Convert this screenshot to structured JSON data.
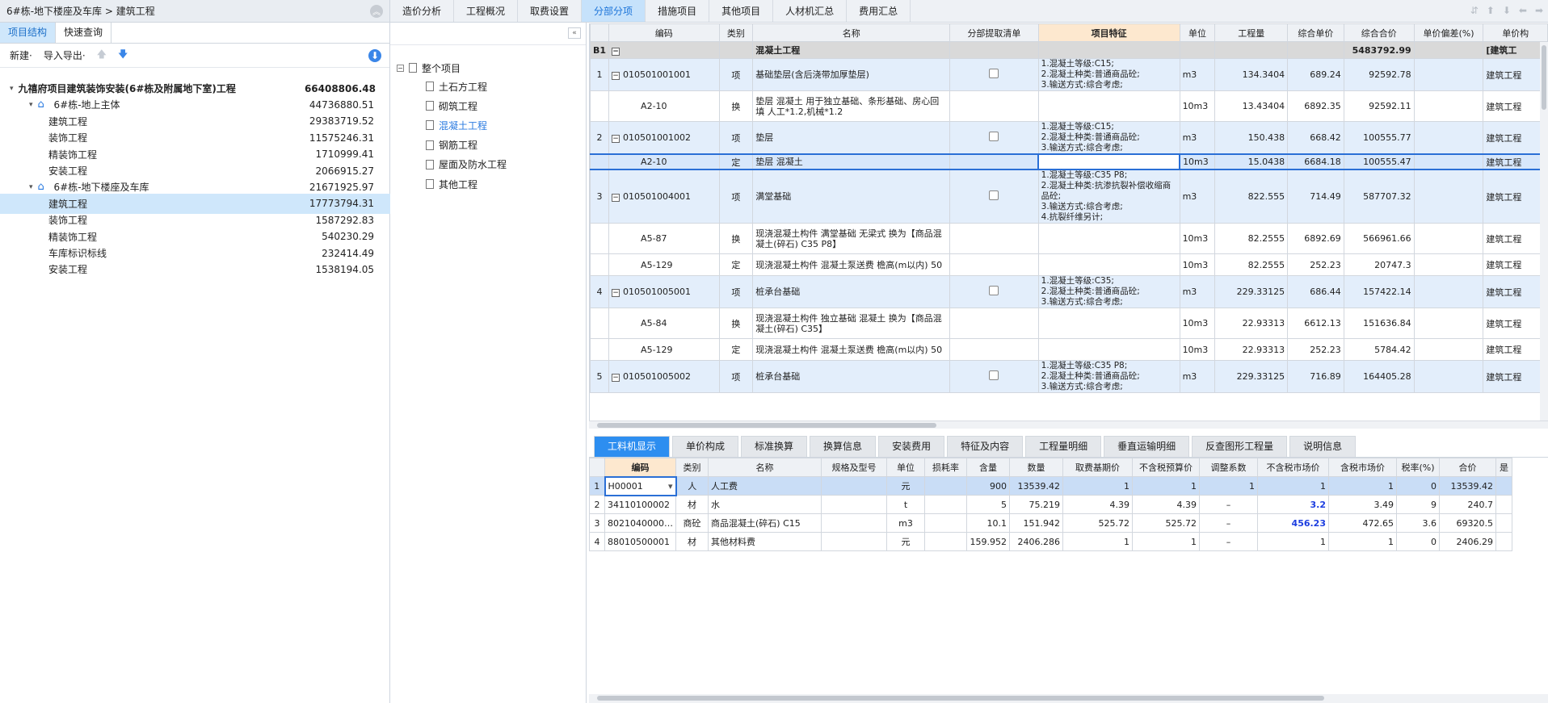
{
  "left": {
    "breadcrumb": "6#栋-地下楼座及车库 > 建筑工程",
    "tabs": [
      "项目结构",
      "快速查询"
    ],
    "tools": {
      "new": "新建·",
      "io": "导入导出·"
    },
    "tree": [
      {
        "label": "九禧府项目建筑装饰安装(6#栋及附属地下室)工程",
        "value": "66408806.48",
        "level": 0
      },
      {
        "label": "6#栋-地上主体",
        "value": "44736880.51",
        "level": 1
      },
      {
        "label": "建筑工程",
        "value": "29383719.52",
        "level": 2
      },
      {
        "label": "装饰工程",
        "value": "11575246.31",
        "level": 2
      },
      {
        "label": "精装饰工程",
        "value": "1710999.41",
        "level": 2
      },
      {
        "label": "安装工程",
        "value": "2066915.27",
        "level": 2
      },
      {
        "label": "6#栋-地下楼座及车库",
        "value": "21671925.97",
        "level": 1
      },
      {
        "label": "建筑工程",
        "value": "17773794.31",
        "level": 2
      },
      {
        "label": "装饰工程",
        "value": "1587292.83",
        "level": 2
      },
      {
        "label": "精装饰工程",
        "value": "540230.29",
        "level": 2
      },
      {
        "label": "车库标识标线",
        "value": "232414.49",
        "level": 2
      },
      {
        "label": "安装工程",
        "value": "1538194.05",
        "level": 2
      }
    ]
  },
  "mid": {
    "root": "整个项目",
    "items": [
      "土石方工程",
      "砌筑工程",
      "混凝土工程",
      "钢筋工程",
      "屋面及防水工程",
      "其他工程"
    ]
  },
  "toptabs": [
    "造价分析",
    "工程概况",
    "取费设置",
    "分部分项",
    "措施项目",
    "其他项目",
    "人材机汇总",
    "费用汇总"
  ],
  "grid": {
    "headers": [
      "",
      "编码",
      "类别",
      "名称",
      "分部提取清单",
      "项目特征",
      "单位",
      "工程量",
      "综合单价",
      "综合合价",
      "单价偏差(%)",
      "单价构"
    ],
    "section": {
      "idx": "B1",
      "name": "混凝土工程",
      "total": "5483792.99",
      "tail": "[建筑工"
    },
    "rows": [
      {
        "t": "item",
        "idx": "1",
        "code": "010501001001",
        "cat": "项",
        "name": "基础垫层(含后浇带加厚垫层)",
        "feat": "1.混凝土等级:C15;\n2.混凝土种类:普通商品砼;\n3.输送方式:综合考虑;",
        "unit": "m3",
        "qty": "134.3404",
        "price": "689.24",
        "total": "92592.78",
        "tail": "建筑工程"
      },
      {
        "t": "sub",
        "idx": "",
        "code": "A2-10",
        "cat": "换",
        "name": "垫层 混凝土  用于独立基础、条形基础、房心回填 人工*1.2,机械*1.2",
        "feat": "",
        "unit": "10m3",
        "qty": "13.43404",
        "price": "6892.35",
        "total": "92592.11",
        "tail": "建筑工程"
      },
      {
        "t": "item",
        "idx": "2",
        "code": "010501001002",
        "cat": "项",
        "name": "垫层",
        "feat": "1.混凝土等级:C15;\n2.混凝土种类:普通商品砼;\n3.输送方式:综合考虑;",
        "unit": "m3",
        "qty": "150.438",
        "price": "668.42",
        "total": "100555.77",
        "tail": "建筑工程"
      },
      {
        "t": "cur",
        "idx": "",
        "code": "A2-10",
        "cat": "定",
        "name": "垫层 混凝土",
        "feat": "",
        "unit": "10m3",
        "qty": "15.0438",
        "price": "6684.18",
        "total": "100555.47",
        "tail": "建筑工程"
      },
      {
        "t": "item",
        "idx": "3",
        "code": "010501004001",
        "cat": "项",
        "name": "满堂基础",
        "feat": "1.混凝土等级:C35 P8;\n2.混凝土种类:抗渗抗裂补偿收缩商品砼;\n3.输送方式:综合考虑;\n4.抗裂纤维另计;",
        "unit": "m3",
        "qty": "822.555",
        "price": "714.49",
        "total": "587707.32",
        "tail": "建筑工程"
      },
      {
        "t": "sub",
        "idx": "",
        "code": "A5-87",
        "cat": "换",
        "name": "现浇混凝土构件 满堂基础 无梁式  换为【商品混凝土(碎石) C35 P8】",
        "feat": "",
        "unit": "10m3",
        "qty": "82.2555",
        "price": "6892.69",
        "total": "566961.66",
        "tail": "建筑工程"
      },
      {
        "t": "sub",
        "idx": "",
        "code": "A5-129",
        "cat": "定",
        "name": "现浇混凝土构件 混凝土泵送费 檐高(m以内) 50",
        "feat": "",
        "unit": "10m3",
        "qty": "82.2555",
        "price": "252.23",
        "total": "20747.3",
        "tail": "建筑工程"
      },
      {
        "t": "item",
        "idx": "4",
        "code": "010501005001",
        "cat": "项",
        "name": "桩承台基础",
        "feat": "1.混凝土等级:C35;\n2.混凝土种类:普通商品砼;\n3.输送方式:综合考虑;",
        "unit": "m3",
        "qty": "229.33125",
        "price": "686.44",
        "total": "157422.14",
        "tail": "建筑工程"
      },
      {
        "t": "sub",
        "idx": "",
        "code": "A5-84",
        "cat": "换",
        "name": "现浇混凝土构件 独立基础 混凝土  换为【商品混凝土(碎石) C35】",
        "feat": "",
        "unit": "10m3",
        "qty": "22.93313",
        "price": "6612.13",
        "total": "151636.84",
        "tail": "建筑工程"
      },
      {
        "t": "sub",
        "idx": "",
        "code": "A5-129",
        "cat": "定",
        "name": "现浇混凝土构件 混凝土泵送费 檐高(m以内) 50",
        "feat": "",
        "unit": "10m3",
        "qty": "22.93313",
        "price": "252.23",
        "total": "5784.42",
        "tail": "建筑工程"
      },
      {
        "t": "item",
        "idx": "5",
        "code": "010501005002",
        "cat": "项",
        "name": "桩承台基础",
        "feat": "1.混凝土等级:C35 P8;\n2.混凝土种类:普通商品砼;\n3.输送方式:综合考虑;",
        "unit": "m3",
        "qty": "229.33125",
        "price": "716.89",
        "total": "164405.28",
        "tail": "建筑工程"
      }
    ]
  },
  "btabs": [
    "工料机显示",
    "单价构成",
    "标准换算",
    "换算信息",
    "安装费用",
    "特征及内容",
    "工程量明细",
    "垂直运输明细",
    "反查图形工程量",
    "说明信息"
  ],
  "bgrid": {
    "headers": [
      "",
      "编码",
      "类别",
      "名称",
      "规格及型号",
      "单位",
      "损耗率",
      "含量",
      "数量",
      "取费基期价",
      "不含税预算价",
      "调整系数",
      "不含税市场价",
      "含税市场价",
      "税率(%)",
      "合价",
      "是"
    ],
    "rows": [
      [
        "1",
        "H00001",
        "人",
        "人工费",
        "",
        "元",
        "",
        "900",
        "13539.42",
        "1",
        "1",
        "1",
        "1",
        "1",
        "0",
        "13539.42"
      ],
      [
        "2",
        "34110100002",
        "材",
        "水",
        "",
        "t",
        "",
        "5",
        "75.219",
        "4.39",
        "4.39",
        "–",
        "3.2",
        "3.49",
        "9",
        "240.7"
      ],
      [
        "3",
        "8021040000…",
        "商砼",
        "商品混凝土(碎石) C15",
        "",
        "m3",
        "",
        "10.1",
        "151.942",
        "525.72",
        "525.72",
        "–",
        "456.23",
        "472.65",
        "3.6",
        "69320.5"
      ],
      [
        "4",
        "88010500001",
        "材",
        "其他材料费",
        "",
        "元",
        "",
        "159.952",
        "2406.286",
        "1",
        "1",
        "–",
        "1",
        "1",
        "0",
        "2406.29"
      ]
    ]
  }
}
